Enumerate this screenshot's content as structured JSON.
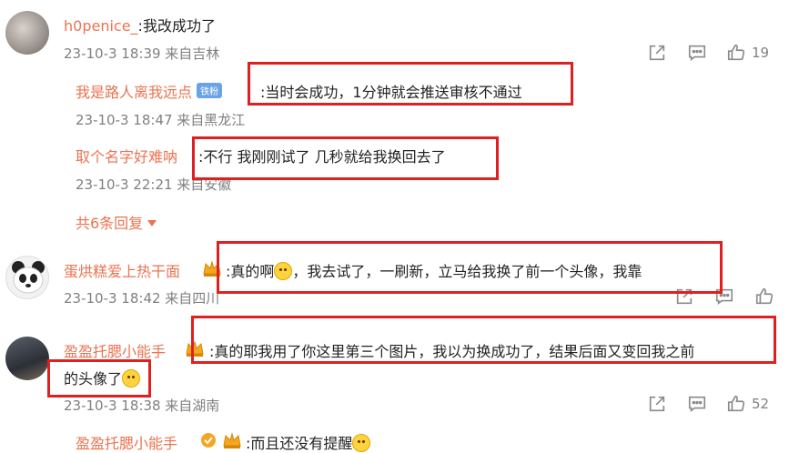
{
  "comments": [
    {
      "user": "h0penice_",
      "text": ":我改成功了",
      "meta": "23-10-3 18:39 来自吉林",
      "likes": "19",
      "replies": [
        {
          "user": "我是路人离我远点",
          "badge": "铁粉",
          "text": ":当时会成功，1分钟就会推送审核不通过",
          "meta": "23-10-3 18:47 来自黑龙江"
        },
        {
          "user": "取个名字好难呐",
          "text": ":不行 我刚刚试了 几秒就给我换回去了",
          "meta": "23-10-3 22:21 来自安徽"
        }
      ],
      "more_replies": "共6条回复"
    },
    {
      "user": "蛋烘糕爱上热干面",
      "text_a": ":真的啊",
      "text_b": "，我去试了，一刷新，立马给我换了前一个头像，我靠",
      "meta": "23-10-3 18:42 来自四川"
    },
    {
      "user": "盈盈托腮小能手",
      "text_line1": ":真的耶我用了你这里第三个图片，我以为换成功了，结果后面又变回我之前",
      "text_line2": "的头像了",
      "meta": "23-10-3 18:38 来自湖南",
      "likes": "52",
      "replies": [
        {
          "user": "盈盈托腮小能手",
          "text": ":而且还没有提醒"
        }
      ]
    }
  ],
  "icons": {
    "share": "share-icon",
    "comment": "comment-icon",
    "like": "thumbs-up-icon",
    "crown": "crown-badge-icon",
    "verified": "verified-badge-icon",
    "emoji": "emoji-icon",
    "caret": "caret-down-icon"
  },
  "colors": {
    "username": "#eb7350",
    "highlight_box": "#e02020",
    "meta": "#808080"
  }
}
